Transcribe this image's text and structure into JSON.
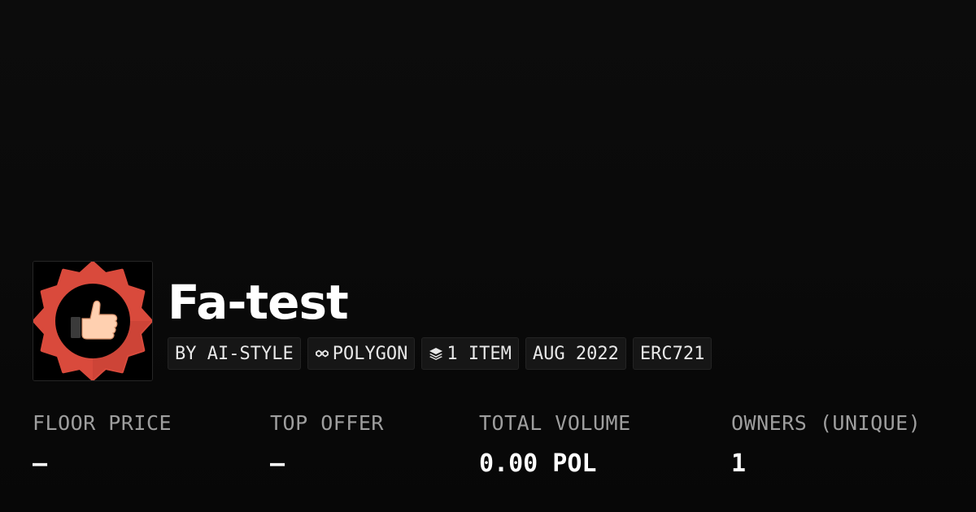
{
  "collection": {
    "name": "Fa-test",
    "logo_icon": "thumbs-up-badge-icon",
    "logo_colors": {
      "badge": "#d94a3c",
      "badge_shadow": "#b83a2e",
      "center": "#000000",
      "thumb": "#ffd0b0"
    }
  },
  "tags": {
    "creator": "BY AI-STYLE",
    "chain": "POLYGON",
    "chain_icon": "polygon-chain-icon",
    "items": "1 ITEM",
    "items_icon": "layers-icon",
    "date": "AUG 2022",
    "standard": "ERC721"
  },
  "stats": {
    "floor_price": {
      "label": "FLOOR PRICE",
      "value": "–"
    },
    "top_offer": {
      "label": "TOP OFFER",
      "value": "–"
    },
    "total_volume": {
      "label": "TOTAL VOLUME",
      "value": "0.00 POL"
    },
    "owners": {
      "label": "OWNERS (UNIQUE)",
      "value": "1"
    }
  },
  "colors": {
    "background": "#0a0a0a",
    "tag_background": "#161616",
    "label_gray": "#9e9e9e"
  }
}
